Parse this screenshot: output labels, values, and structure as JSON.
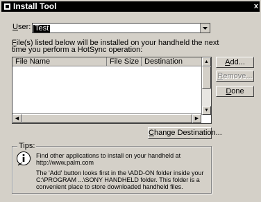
{
  "window": {
    "title": "Install Tool",
    "close_glyph": "x"
  },
  "user": {
    "label_u": "U",
    "label_rest": "ser:",
    "selected": "Test"
  },
  "intro": {
    "line1_u": "F",
    "line1_rest": "ile(s) listed below will be installed on your handheld the next",
    "line2": "time you perform a HotSync operation:"
  },
  "file_list": {
    "columns": [
      "File Name",
      "File Size",
      "Destination"
    ],
    "rows": []
  },
  "buttons": {
    "add": {
      "u": "A",
      "rest": "dd..."
    },
    "remove": {
      "u": "R",
      "rest": "emove..."
    },
    "done": {
      "u": "D",
      "rest": "one"
    },
    "change_dest": {
      "u": "C",
      "rest": "hange Destination..."
    }
  },
  "tips": {
    "legend": "Tips:",
    "line1": "Find other applications to install on your handheld at",
    "line2": "http://www.palm.com",
    "para2_line1": "The 'Add' button looks first in the \\ADD-ON folder inside your",
    "para2_line2": "C:\\PROGRAM ...\\SONY HANDHELD folder. This folder is a",
    "para2_line3": "convenient place to store downloaded handheld files."
  },
  "icons": {
    "system": "palm-app-icon",
    "info": "info-icon"
  }
}
